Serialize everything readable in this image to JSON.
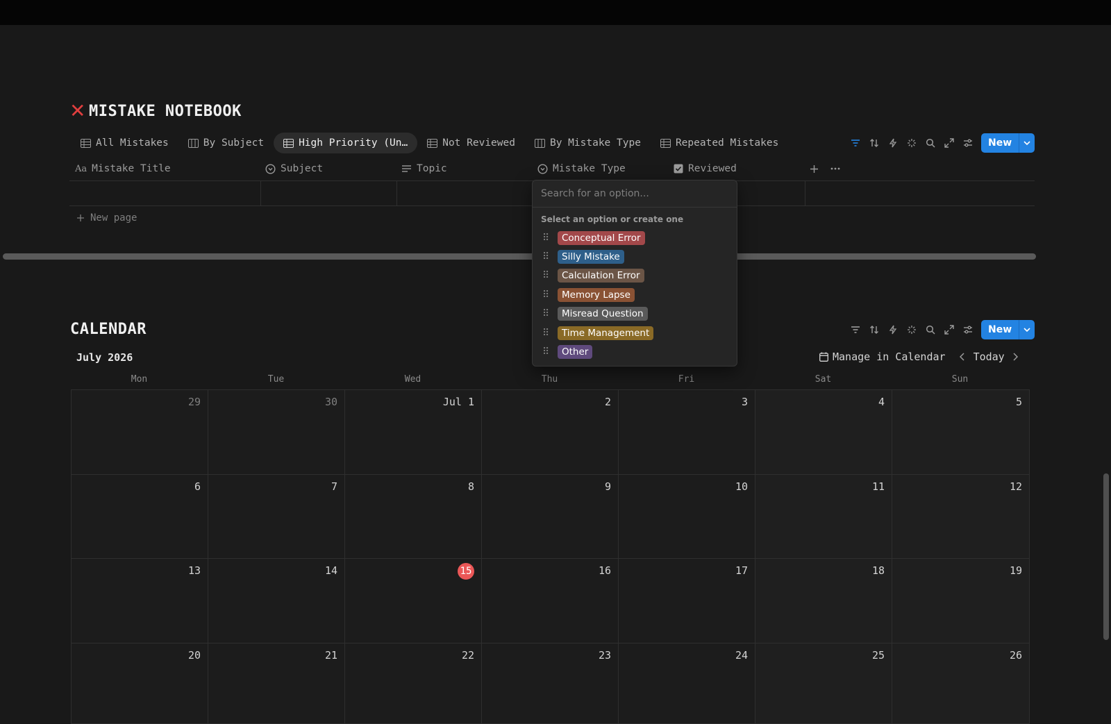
{
  "notebook": {
    "title": "MISTAKE NOTEBOOK",
    "tabs": [
      {
        "label": "All Mistakes",
        "icon": "table-icon"
      },
      {
        "label": "By Subject",
        "icon": "board-icon"
      },
      {
        "label": "High Priority (Un…",
        "icon": "table-icon",
        "active": true
      },
      {
        "label": "Not Reviewed",
        "icon": "table-icon"
      },
      {
        "label": "By Mistake Type",
        "icon": "board-icon"
      },
      {
        "label": "Repeated Mistakes",
        "icon": "table-icon"
      }
    ],
    "new_label": "New",
    "columns": {
      "title": "Mistake Title",
      "subject": "Subject",
      "topic": "Topic",
      "mistake_type": "Mistake Type",
      "reviewed": "Reviewed"
    },
    "new_page_label": "New page"
  },
  "dropdown": {
    "placeholder": "Search for an option...",
    "hint": "Select an option or create one",
    "options": [
      {
        "label": "Conceptual Error",
        "color": "#a2484a"
      },
      {
        "label": "Silly Mistake",
        "color": "#2e5f8a"
      },
      {
        "label": "Calculation Error",
        "color": "#6b5546"
      },
      {
        "label": "Memory Lapse",
        "color": "#8a5234"
      },
      {
        "label": "Misread Question",
        "color": "#5a5a5a"
      },
      {
        "label": "Time Management",
        "color": "#8a6a26"
      },
      {
        "label": "Other",
        "color": "#5f4a7d"
      }
    ]
  },
  "calendar": {
    "title": "CALENDAR",
    "new_label": "New",
    "month": "July 2026",
    "manage_label": "Manage in Calendar",
    "today_label": "Today",
    "weekdays": [
      "Mon",
      "Tue",
      "Wed",
      "Thu",
      "Fri",
      "Sat",
      "Sun"
    ],
    "days": [
      "29",
      "30",
      "Jul 1",
      "2",
      "3",
      "4",
      "5",
      "6",
      "7",
      "8",
      "9",
      "10",
      "11",
      "12",
      "13",
      "14",
      "15",
      "16",
      "17",
      "18",
      "19",
      "20",
      "21",
      "22",
      "23",
      "24",
      "25",
      "26"
    ],
    "today": "15"
  },
  "colors": {
    "accent": "#2383e2",
    "today": "#eb5757",
    "title_x": "#e03e3e"
  }
}
